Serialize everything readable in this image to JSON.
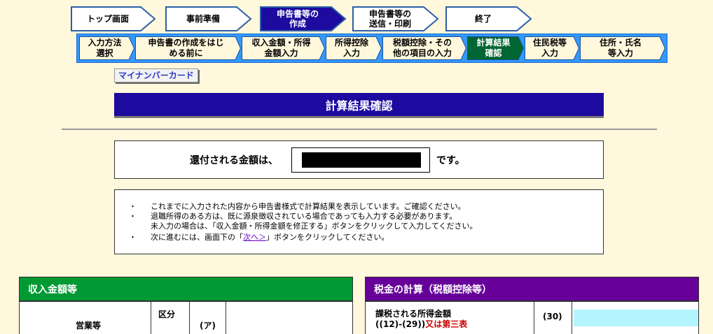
{
  "steps": [
    {
      "label": "トップ画面",
      "active": false
    },
    {
      "label": "事前準備",
      "active": false
    },
    {
      "label": "申告書等の\n作成",
      "active": true
    },
    {
      "label": "申告書等の\n送信・印刷",
      "active": false
    },
    {
      "label": "終了",
      "active": false
    }
  ],
  "substeps": [
    {
      "label": "入力方法\n選択",
      "active": false
    },
    {
      "label": "申告書の作成をはじ\nめる前に",
      "active": false
    },
    {
      "label": "収入金額・所得\n金額入力",
      "active": false
    },
    {
      "label": "所得控除\n入力",
      "active": false
    },
    {
      "label": "税額控除・その\n他の項目の入力",
      "active": false
    },
    {
      "label": "計算結果\n確認",
      "active": true
    },
    {
      "label": "住民税等\n入力",
      "active": false
    },
    {
      "label": "住所・氏名\n等入力",
      "active": false
    }
  ],
  "mynumber_link": "マイナンバーカード",
  "page_title": "計算結果確認",
  "refund": {
    "prefix": "還付される金額は、",
    "suffix": "です。"
  },
  "info": {
    "bullet": "・",
    "line1": "これまでに入力された内容から申告書様式で計算結果を表示しています。ご確認ください。",
    "line2": "退職所得のある方は、既に源泉徴収されている場合であっても入力する必要があります。",
    "line3": "未入力の場合は、「収入金額・所得金額を修正する」ボタンをクリックして入力してください。",
    "line4_pre": "次に進むには、画面下の「",
    "line4_link": "次へ＞",
    "line4_post": "」ボタンをクリックしてください。"
  },
  "income_panel": {
    "title": "収入金額等",
    "row_label": "営業等",
    "kubun": "区分",
    "code": "(ア)"
  },
  "tax_panel": {
    "title": "税金の計算（税額控除等）",
    "row_label_1": "課税される所得金額",
    "row_label_2a": "((12)-(29))",
    "row_label_2b": "又は第三表",
    "code": "(30)"
  },
  "colors": {
    "background": "#fff8dc",
    "step_active": "#1d0a9e",
    "substep_active": "#006633",
    "title_bar": "#1d0a9e",
    "income_head": "#009933",
    "tax_head": "#660099",
    "highlight_cell": "#b3f5ff",
    "red_text": "#cc0000"
  }
}
